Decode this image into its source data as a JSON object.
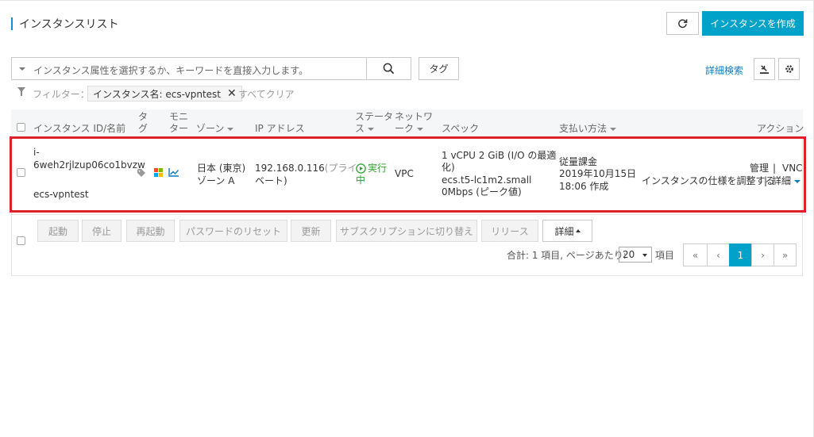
{
  "page": {
    "title": "インスタンスリスト",
    "create_button": "インスタンスを作成"
  },
  "search": {
    "placeholder": "インスタンス属性を選択するか、キーワードを直接入力します。",
    "tag_button": "タグ",
    "advanced_search": "詳細検索"
  },
  "filter": {
    "label": "フィルター：",
    "tag": "インスタンス名: ecs-vpntest",
    "clear_all": "すべてクリア"
  },
  "table": {
    "headers": {
      "instance_id": "インスタンス ID/名前",
      "tag_1": "タ",
      "tag_2": "グ",
      "monitor_1": "モニ",
      "monitor_2": "ター",
      "zone": "ゾーン",
      "ip": "IP アドレス",
      "status_1": "ステータ",
      "status_2": "ス",
      "network_1": "ネットワ",
      "network_2": "ーク",
      "spec": "スペック",
      "billing": "支払い方法",
      "action": "アクション"
    },
    "row": {
      "id_1": "i-",
      "id_2": "6weh2rjlzup06co1bvzw",
      "name": "ecs-vpntest",
      "zone_1": "日本 (東京)",
      "zone_2": "ゾーン A",
      "ip": "192.168.0.116",
      "ip_type_1": "(プライ",
      "ip_type_2": "ベート)",
      "status_1": "実行",
      "status_2": "中",
      "network": "VPC",
      "spec_1": "1 vCPU 2 GiB (I/O の最適",
      "spec_2": "化)",
      "spec_type": "ecs.t5-lc1m2.small",
      "spec_bw": "0Mbps (ピーク値)",
      "billing_1": "従量課金",
      "billing_2": "2019年10月15日",
      "billing_3": "18:06 作成",
      "action_manage": "管理",
      "action_vnc": "VNC",
      "action_resize": "インスタンスの仕様を調整する",
      "action_more": "詳細"
    }
  },
  "actions": {
    "start": "起動",
    "stop": "停止",
    "restart": "再起動",
    "reset_password": "パスワードのリセット",
    "renew": "更新",
    "switch_subscription": "サブスクリプションに切り替え",
    "release": "リリース",
    "more": "詳細"
  },
  "pagination": {
    "summary": "合計: 1 項目, ページあたり:",
    "page_size": "20",
    "items_label": "項目",
    "first": "«",
    "prev": "‹",
    "current": "1",
    "next": "›",
    "last": "»"
  },
  "colors": {
    "primary": "#00a2ca",
    "link": "#0c7bc1",
    "highlight": "#e0202a",
    "running": "#2aa32a"
  }
}
